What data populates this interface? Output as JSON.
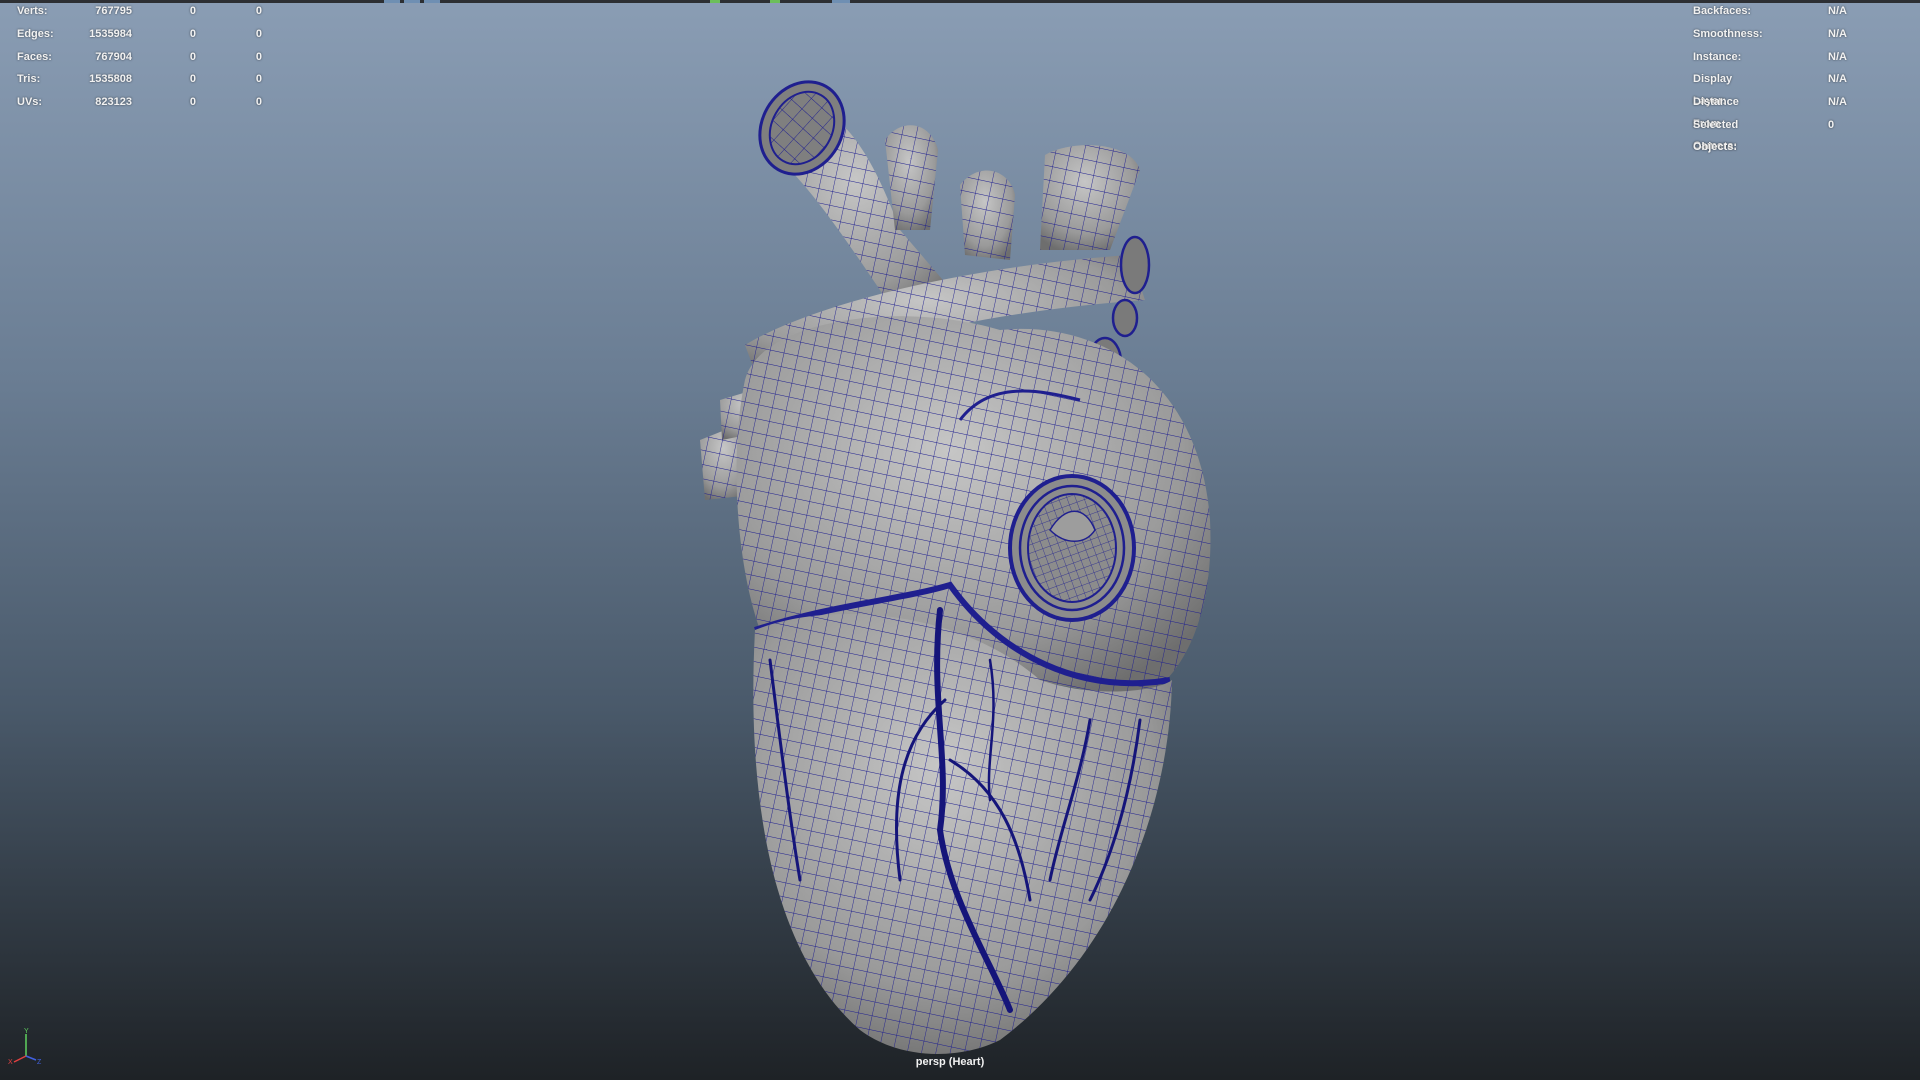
{
  "stats": [
    {
      "label": "Verts:",
      "value": "767795",
      "selected": "0",
      "component": "0"
    },
    {
      "label": "Edges:",
      "value": "1535984",
      "selected": "0",
      "component": "0"
    },
    {
      "label": "Faces:",
      "value": "767904",
      "selected": "0",
      "component": "0"
    },
    {
      "label": "Tris:",
      "value": "1535808",
      "selected": "0",
      "component": "0"
    },
    {
      "label": "UVs:",
      "value": "823123",
      "selected": "0",
      "component": "0"
    }
  ],
  "object_info": [
    {
      "label": "Backfaces:",
      "value": "N/A"
    },
    {
      "label": "Smoothness:",
      "value": "N/A"
    },
    {
      "label": "Instance:",
      "value": "N/A"
    },
    {
      "label": "Display Layer:",
      "value": "N/A"
    },
    {
      "label": "Distance From Camera:",
      "value": "N/A"
    },
    {
      "label": "Selected Objects:",
      "value": "0"
    }
  ],
  "viewport": {
    "camera_label": "persp (Heart)",
    "wireframe_color": "#1a1a8c",
    "mesh_color": "#a9a9a9"
  },
  "axis": {
    "x": "X",
    "y": "Y",
    "z": "Z"
  }
}
